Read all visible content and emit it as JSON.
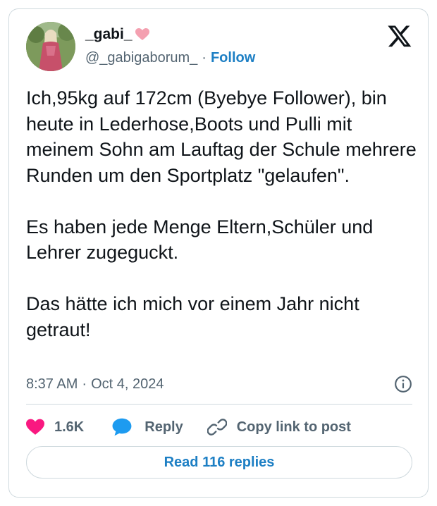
{
  "user": {
    "display_name": "_gabi_",
    "handle": "@_gabigaborum_",
    "separator": "·",
    "follow_label": "Follow"
  },
  "tweet": {
    "text": "Ich,95kg auf 172cm (Byebye Follower), bin heute in Lederhose,Boots und Pulli mit meinem Sohn am Lauftag der Schule mehrere Runden um den Sportplatz \"gelaufen\".\n\nEs haben jede Menge Eltern,Schüler und Lehrer zugeguckt.\n\nDas hätte ich mich vor einem Jahr nicht getraut!",
    "time": "8:37 AM",
    "separator": "·",
    "date": "Oct 4, 2024"
  },
  "actions": {
    "like_count": "1.6K",
    "reply_label": "Reply",
    "copy_label": "Copy link to post"
  },
  "read_replies_label": "Read 116 replies",
  "icons": {
    "logo": "x-logo-icon",
    "info": "info-icon",
    "like": "heart-icon",
    "reply": "speech-bubble-icon",
    "copy": "link-icon",
    "name_emoji": "pink-heart-emoji-icon"
  },
  "colors": {
    "accent": "#1d7fc4",
    "like": "#f91880",
    "reply": "#1d9bf0",
    "muted_text": "#536471",
    "border": "#cfd9de"
  }
}
